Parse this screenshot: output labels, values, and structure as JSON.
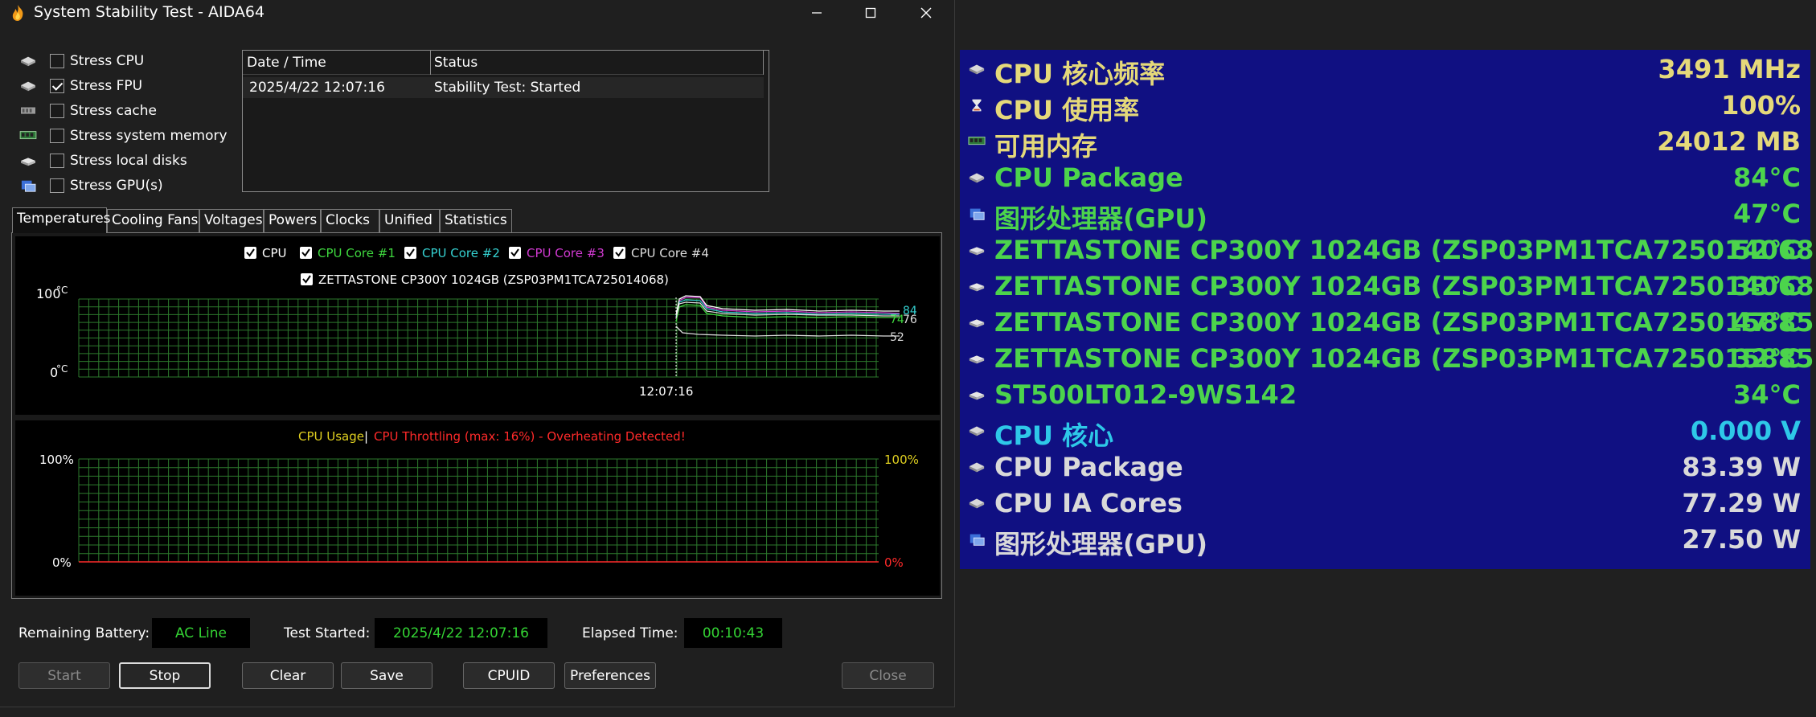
{
  "window": {
    "title": "System Stability Test - AIDA64",
    "min_glyph": "—",
    "close_glyph": "✕"
  },
  "stress_options": [
    {
      "label": "Stress CPU",
      "checked": false,
      "icon": "cpu-chip-icon"
    },
    {
      "label": "Stress FPU",
      "checked": true,
      "icon": "fpu-chip-icon"
    },
    {
      "label": "Stress cache",
      "checked": false,
      "icon": "cache-chip-icon"
    },
    {
      "label": "Stress system memory",
      "checked": false,
      "icon": "memory-module-icon"
    },
    {
      "label": "Stress local disks",
      "checked": false,
      "icon": "disk-drive-icon"
    },
    {
      "label": "Stress GPU(s)",
      "checked": false,
      "icon": "gpu-card-icon"
    }
  ],
  "log": {
    "col_datetime": "Date / Time",
    "col_status": "Status",
    "rows": [
      {
        "datetime": "2025/4/22 12:07:16",
        "status": "Stability Test: Started"
      }
    ]
  },
  "tabs": [
    "Temperatures",
    "Cooling Fans",
    "Voltages",
    "Powers",
    "Clocks",
    "Unified",
    "Statistics"
  ],
  "active_tab": "Temperatures",
  "temp_graph": {
    "legend": [
      {
        "label": "CPU",
        "color": "#ffffff",
        "checked": true
      },
      {
        "label": "CPU Core #1",
        "color": "#3ed63e",
        "checked": true
      },
      {
        "label": "CPU Core #2",
        "color": "#35d1d1",
        "checked": true
      },
      {
        "label": "CPU Core #3",
        "color": "#d23ad2",
        "checked": true
      },
      {
        "label": "CPU Core #4",
        "color": "#dcdcdc",
        "checked": true
      }
    ],
    "legend2": {
      "label": "ZETTASTONE CP300Y 1024GB (ZSP03PM1TCA725014068)",
      "color": "#ffffff",
      "checked": true
    },
    "y_max": "100",
    "y_min": "0",
    "unit": "°C",
    "time_label": "12:07:16",
    "right_values": [
      {
        "text": "84",
        "color": "#35d1d1"
      },
      {
        "text": "76",
        "color": "#e0e0e0"
      },
      {
        "text": "74",
        "color": "#3ed63e"
      },
      {
        "text": "52",
        "color": "#dcdcdc"
      }
    ]
  },
  "usage_graph": {
    "usage_label": "CPU Usage",
    "separator": "|",
    "throttle_label": "CPU Throttling (max: 16%) - Overheating Detected!",
    "left_max": "100%",
    "left_min": "0%",
    "right_max": "100%",
    "right_min": "0%",
    "usage_color": "#e0d020",
    "throttle_color": "#ff2a2a"
  },
  "status": {
    "battery_label": "Remaining Battery:",
    "battery_value": "AC Line",
    "started_label": "Test Started:",
    "started_value": "2025/4/22 12:07:16",
    "elapsed_label": "Elapsed Time:",
    "elapsed_value": "00:10:43"
  },
  "buttons": {
    "start": "Start",
    "stop": "Stop",
    "clear": "Clear",
    "save": "Save",
    "cpuid": "CPUID",
    "preferences": "Preferences",
    "close": "Close"
  },
  "osd": [
    {
      "label": "CPU 核心频率",
      "value": "3491 MHz",
      "color": "#e5d97a",
      "icon": "cpu-chip-icon"
    },
    {
      "label": "CPU 使用率",
      "value": "100%",
      "color": "#e5d97a",
      "icon": "hourglass-icon"
    },
    {
      "label": "可用内存",
      "value": "24012 MB",
      "color": "#e5d97a",
      "icon": "memory-module-icon"
    },
    {
      "label": "CPU Package",
      "value": "84°C",
      "color": "#4cd44c",
      "icon": "cpu-chip-icon"
    },
    {
      "label": "图形处理器(GPU)",
      "value": "47°C",
      "color": "#4cd44c",
      "icon": "gpu-card-icon"
    },
    {
      "label": "ZETTASTONE CP300Y 1024GB (ZSP03PM1TCA725014068)",
      "value": "52°C",
      "color": "#4cd44c",
      "icon": "disk-drive-icon"
    },
    {
      "label": "ZETTASTONE CP300Y 1024GB (ZSP03PM1TCA725014068) #2",
      "value": "33°C",
      "color": "#4cd44c",
      "icon": "disk-drive-icon"
    },
    {
      "label": "ZETTASTONE CP300Y 1024GB (ZSP03PM1TCA725015885)",
      "value": "47°C",
      "color": "#4cd44c",
      "icon": "disk-drive-icon"
    },
    {
      "label": "ZETTASTONE CP300Y 1024GB (ZSP03PM1TCA725015885) #2",
      "value": "32°C",
      "color": "#4cd44c",
      "icon": "disk-drive-icon"
    },
    {
      "label": "ST500LT012-9WS142",
      "value": "34°C",
      "color": "#4cd44c",
      "icon": "disk-drive-icon"
    },
    {
      "label": "CPU 核心",
      "value": "0.000 V",
      "color": "#2ec8e8",
      "icon": "cpu-chip-icon"
    },
    {
      "label": "CPU Package",
      "value": "83.39 W",
      "color": "#d9d9d9",
      "icon": "cpu-chip-icon"
    },
    {
      "label": "CPU IA Cores",
      "value": "77.29 W",
      "color": "#d9d9d9",
      "icon": "cpu-chip-icon"
    },
    {
      "label": "图形处理器(GPU)",
      "value": "27.50 W",
      "color": "#d9d9d9",
      "icon": "gpu-card-icon"
    }
  ]
}
